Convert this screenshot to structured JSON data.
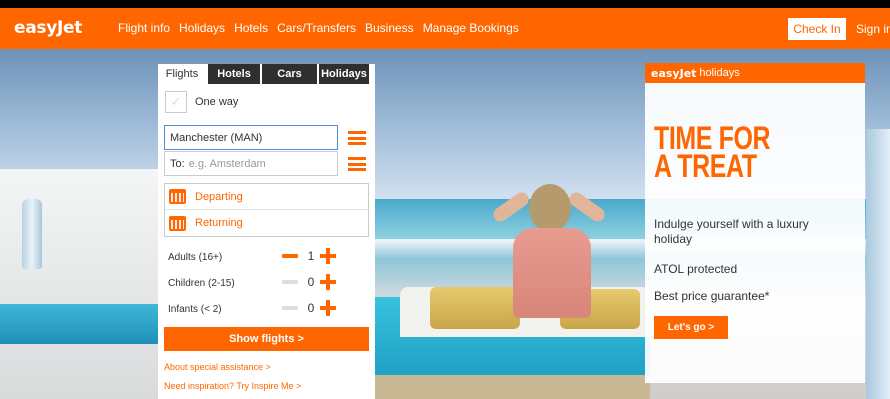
{
  "header": {
    "logo": "easyJet",
    "nav": [
      "Flight info",
      "Holidays",
      "Hotels",
      "Cars/Transfers",
      "Business",
      "Manage Bookings"
    ],
    "check_in": "Check In",
    "sign_in": "Sign in"
  },
  "booking": {
    "tabs": [
      "Flights",
      "Hotels",
      "Cars",
      "Holidays"
    ],
    "active_tab": "Flights",
    "one_way_label": "One way",
    "from_value": "Manchester (MAN)",
    "to_label": "To:",
    "to_placeholder": "e.g. Amsterdam",
    "departing": "Departing",
    "returning": "Returning",
    "passengers": [
      {
        "label": "Adults (16+)",
        "count": "1"
      },
      {
        "label": "Children (2-15)",
        "count": "0"
      },
      {
        "label": "Infants (< 2)",
        "count": "0"
      }
    ],
    "show_flights": "Show flights >",
    "link_assistance": "About special assistance >",
    "link_inspire": "Need inspiration? Try Inspire Me >"
  },
  "ad": {
    "brand": "easyJet",
    "brand_suffix": "holidays",
    "title_line1": "TIME FOR",
    "title_line2": "A TREAT",
    "text1": "Indulge yourself with a luxury holiday",
    "text2": "ATOL protected",
    "text3": "Best price guarantee*",
    "button": "Let's go >"
  },
  "colors": {
    "brand_orange": "#ff6600",
    "tab_dark": "#2f2f2f"
  }
}
